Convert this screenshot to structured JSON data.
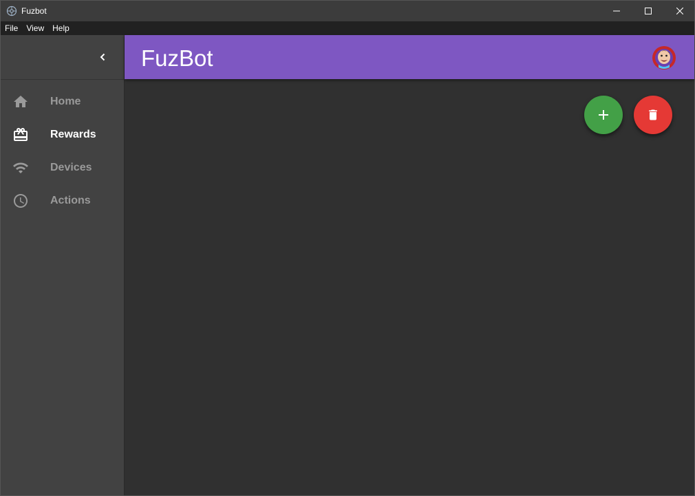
{
  "window": {
    "title": "Fuzbot"
  },
  "menu": {
    "items": [
      "File",
      "View",
      "Help"
    ]
  },
  "sidebar": {
    "items": [
      {
        "label": "Home",
        "icon": "home-icon",
        "active": false
      },
      {
        "label": "Rewards",
        "icon": "rewards-icon",
        "active": true
      },
      {
        "label": "Devices",
        "icon": "wifi-icon",
        "active": false
      },
      {
        "label": "Actions",
        "icon": "clock-icon",
        "active": false
      }
    ]
  },
  "appbar": {
    "title": "FuzBot",
    "color": "#7e57c2"
  },
  "actions": {
    "add_color": "#43a047",
    "delete_color": "#e53935"
  }
}
